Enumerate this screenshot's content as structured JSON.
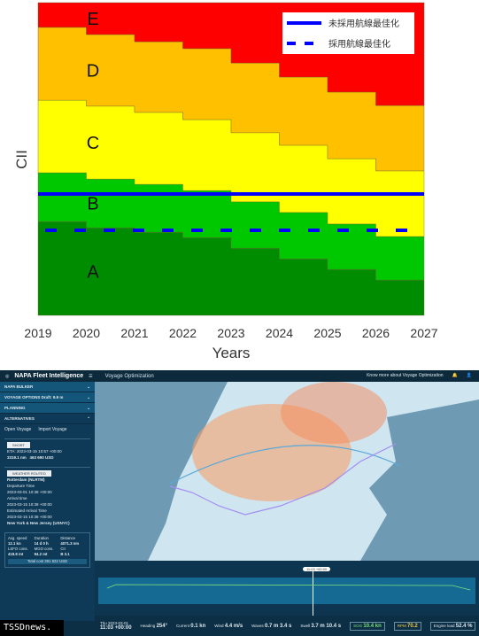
{
  "chart_data": {
    "type": "area",
    "title": "",
    "xlabel": "Years",
    "ylabel": "CII",
    "xlim": [
      2019,
      2027
    ],
    "ylim": [
      0,
      100
    ],
    "x_ticks": [
      "2019",
      "2020",
      "2021",
      "2022",
      "2023",
      "2024",
      "2025",
      "2026",
      "2027"
    ],
    "step_years": [
      2019,
      2020,
      2021,
      2022,
      2023,
      2024,
      2025,
      2026
    ],
    "bands": [
      {
        "label": "A",
        "color": "#008c00",
        "upper": [
          30.0,
          28.0,
          26.6,
          24.9,
          21.5,
          18.1,
          14.7,
          11.3
        ]
      },
      {
        "label": "B",
        "color": "#00c800",
        "upper": [
          45.6,
          43.6,
          41.9,
          39.9,
          36.3,
          32.9,
          29.2,
          25.2
        ]
      },
      {
        "label": "C",
        "color": "#ffff00",
        "upper": [
          68.8,
          66.9,
          64.9,
          62.6,
          58.4,
          54.4,
          50.1,
          46.2
        ]
      },
      {
        "label": "D",
        "color": "#ffc000",
        "upper": [
          92.1,
          89.8,
          87.5,
          85.3,
          80.7,
          76.2,
          71.4,
          67.1
        ]
      },
      {
        "label": "E",
        "color": "#ff0000",
        "upper": [
          100,
          100,
          100,
          100,
          100,
          100,
          100,
          100
        ]
      }
    ],
    "series": [
      {
        "name": "未採用航線最佳化",
        "style": "solid",
        "color": "#0000ff",
        "value": 38.8
      },
      {
        "name": "採用航線最佳化",
        "style": "dashed",
        "color": "#0000ff",
        "value": 27.2
      }
    ],
    "legend": "top-right",
    "grid": false
  },
  "ui": {
    "brand": "NAPA Fleet Intelligence",
    "title": "Voyage Optimization",
    "know_more": "Know more about Voyage Optimization",
    "sections": [
      "NAPA BULKER",
      "VOYAGE OPTIONS Draft: 9.9 m",
      "PLANNING",
      "ALTERNATIVES"
    ],
    "open_voyage": "Open Voyage",
    "import_voyage": "Import Voyage",
    "alt_a": {
      "badge": "SHORT",
      "eta": "ETA: 2023-03-15 10:57 +00:00",
      "distance": "3319.1 nm",
      "cost": "463 690 USD"
    },
    "alt_b": {
      "badge": "WEATHER ROUTED",
      "origin": "Rotterdam (NLRTM)",
      "dep_label": "Departure Time",
      "dep": "2023-03-01 10:38 +00:00",
      "arr_label": "Arrival time",
      "arr": "2023-03-15 10:38 +00:00",
      "eat_label": "Estimated Arrival Time",
      "eat": "2023-03-15 10:38 +00:00",
      "dest": "New York & New Jersey (USNYC)"
    },
    "stats": [
      [
        "Avg. speed",
        "12.1 kn"
      ],
      [
        "Duration",
        "14 d 0 h"
      ],
      [
        "Distance",
        "4071.3 nm"
      ],
      [
        "LSFO cons.",
        "418.8 mt"
      ],
      [
        "MGO cons.",
        "94.2 mt"
      ],
      [
        "CII",
        "B 3.1"
      ]
    ],
    "total_cost": "Total cost 391 822 USD",
    "time_marker": "11:03 +00:00",
    "bottom": {
      "date": "Thu 2023-03-01",
      "time": "11:03 +00:00",
      "heading": [
        "Heading",
        "254°"
      ],
      "current": [
        "Current",
        "0.1 kn"
      ],
      "wind": [
        "Wind",
        "4.4 m/s"
      ],
      "waves": [
        "Waves",
        "0.7 m  3.4 s"
      ],
      "swell": [
        "Swell",
        "3.7 m  10.4 s"
      ],
      "sog": [
        "SOG",
        "10.4 kn"
      ],
      "eng": [
        "RPM",
        "70.2"
      ],
      "engine_load": [
        "Engine load",
        "52.4 %"
      ]
    }
  },
  "watermark": "TSSDnews."
}
